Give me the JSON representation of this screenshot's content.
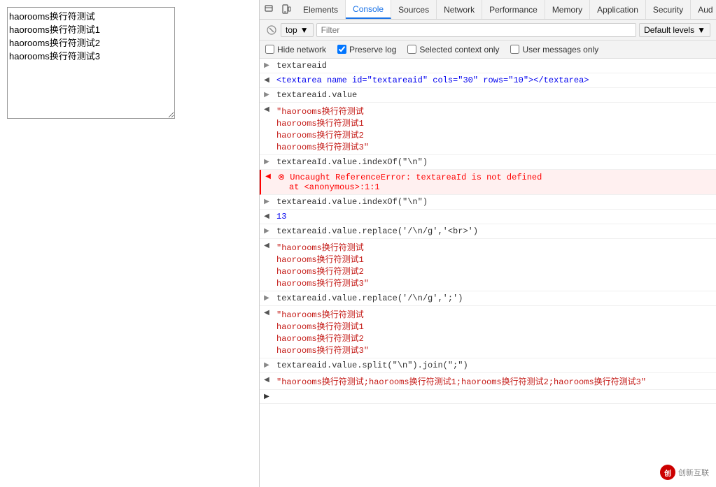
{
  "page": {
    "textarea_value": "haorooms换行符测试\nhaorooms换行符测试1\nhaorooms换行符测试2\nhaorooms换行符测试3"
  },
  "devtools": {
    "tabs": [
      {
        "label": "Elements",
        "active": false
      },
      {
        "label": "Console",
        "active": true
      },
      {
        "label": "Sources",
        "active": false
      },
      {
        "label": "Network",
        "active": false
      },
      {
        "label": "Performance",
        "active": false
      },
      {
        "label": "Memory",
        "active": false
      },
      {
        "label": "Application",
        "active": false
      },
      {
        "label": "Security",
        "active": false
      },
      {
        "label": "Aud",
        "active": false
      }
    ],
    "toolbar": {
      "context": "top",
      "filter_placeholder": "Filter",
      "default_levels": "Default levels"
    },
    "checkboxes": [
      {
        "label": "Hide network",
        "checked": false
      },
      {
        "label": "Preserve log",
        "checked": true
      },
      {
        "label": "Selected context only",
        "checked": false
      },
      {
        "label": "User messages only",
        "checked": false
      }
    ],
    "console_rows": [
      {
        "type": "expand",
        "arrow": "▶",
        "content": "textareaid",
        "color": "dark"
      },
      {
        "type": "result",
        "arrow": "◀",
        "content": "<textarea name id=\"textareaid\" cols=\"30\" rows=\"10\"></textarea>",
        "color": "dark"
      },
      {
        "type": "expand",
        "arrow": "▶",
        "content": "textareaid.value",
        "color": "dark"
      },
      {
        "type": "result_multiline",
        "arrow": "◀",
        "lines": [
          "\"haorooms换行符测试",
          "haorooms换行符测试1",
          "haorooms换行符测试2",
          "haorooms换行符测试3\""
        ],
        "color": "string"
      },
      {
        "type": "expand",
        "arrow": "▶",
        "content": "textareaId.value.indexOf(\"\\n\")",
        "color": "dark"
      },
      {
        "type": "error",
        "arrow": "◀",
        "content": "⊗ Uncaught ReferenceError: textareaId is not defined",
        "sub": "at <anonymous>:1:1",
        "color": "red"
      },
      {
        "type": "expand",
        "arrow": "▶",
        "content": "textareaid.value.indexOf(\"\\n\")",
        "color": "dark"
      },
      {
        "type": "result",
        "arrow": "◀",
        "content": "13",
        "color": "dark"
      },
      {
        "type": "expand",
        "arrow": "▶",
        "content": "textareaid.value.replace('/\\n/g','<br>')",
        "color": "dark"
      },
      {
        "type": "result_multiline",
        "arrow": "◀",
        "lines": [
          "\"haorooms换行符测试",
          "haorooms换行符测试1",
          "haorooms换行符测试2",
          "haorooms换行符测试3\""
        ],
        "color": "string"
      },
      {
        "type": "expand",
        "arrow": "▶",
        "content": "textareaid.value.replace('/\\n/g',';')",
        "color": "dark"
      },
      {
        "type": "result_multiline",
        "arrow": "◀",
        "lines": [
          "\"haorooms换行符测试",
          "haorooms换行符测试1",
          "haorooms换行符测试2",
          "haorooms换行符测试3\""
        ],
        "color": "string"
      },
      {
        "type": "expand",
        "arrow": "▶",
        "content": "textareaid.value.split(\"\\n\").join(\";\")",
        "color": "dark"
      },
      {
        "type": "result",
        "arrow": "◀",
        "content": "\"haorooms换行符测试;haorooms换行符测试1;haorooms换行符测试2;haorooms换行符测试3\"",
        "color": "string"
      },
      {
        "type": "input_prompt",
        "arrow": "▶",
        "content": "",
        "color": "dark"
      }
    ]
  },
  "watermark": {
    "text": "创新互联"
  }
}
